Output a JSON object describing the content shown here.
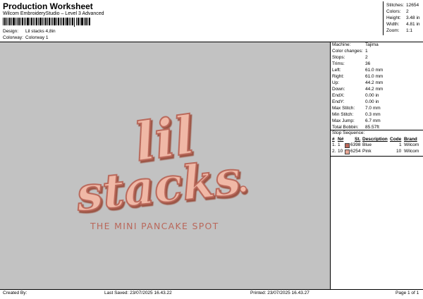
{
  "header": {
    "title": "Production Worksheet",
    "subtitle": "Wilcom EmbroideryStudio – Level 3 Advanced",
    "design_label": "Design:",
    "design_value": "Lil stacks 4,8in",
    "colorway_label": "Colorway:",
    "colorway_value": "Colorway 1"
  },
  "stats": [
    {
      "label": "Stitches:",
      "value": "12654"
    },
    {
      "label": "Colors:",
      "value": "2"
    },
    {
      "label": "Height:",
      "value": "3.48 in"
    },
    {
      "label": "Width:",
      "value": "4.81 in"
    },
    {
      "label": "Zoom:",
      "value": "1:1"
    }
  ],
  "machine_info": [
    {
      "label": "Machine:",
      "value": "Tajima"
    },
    {
      "label": "Color changes:",
      "value": "1"
    },
    {
      "label": "Stops:",
      "value": "2"
    },
    {
      "label": "Trims:",
      "value": "36"
    },
    {
      "label": "Left:",
      "value": "61.0 mm"
    },
    {
      "label": "Right:",
      "value": "61.0 mm"
    },
    {
      "label": "Up:",
      "value": "44.2 mm"
    },
    {
      "label": "Down:",
      "value": "44.2 mm"
    },
    {
      "label": "EndX:",
      "value": "0.00 in"
    },
    {
      "label": "EndY:",
      "value": "0.00 in"
    },
    {
      "label": "Max Stitch:",
      "value": "7.0 mm"
    },
    {
      "label": "Min Stitch:",
      "value": "0.3 mm"
    },
    {
      "label": "Max Jump:",
      "value": "6.7 mm"
    },
    {
      "label": "Total Bobbin:",
      "value": "85.57ft"
    }
  ],
  "stop_sequence": {
    "title": "Stop Sequence:",
    "headers": {
      "num": "#",
      "n": "N#",
      "st": "St.",
      "desc": "Description",
      "code": "Code",
      "brand": "Brand"
    },
    "rows": [
      {
        "num": "1.",
        "n": "1",
        "st": "6398",
        "desc": "Blue",
        "code": "1",
        "brand": "Wilcom",
        "color": "#b9675a"
      },
      {
        "num": "2.",
        "n": "10",
        "st": "6254",
        "desc": "Pink",
        "code": "10",
        "brand": "Wilcom",
        "color": "#e7a695"
      }
    ]
  },
  "design": {
    "line1": "lil",
    "line2": "stacks",
    "dot": ".",
    "tagline": "THE MINI PANCAKE SPOT",
    "thread_light": "#f0b8a6",
    "thread_dark": "#b9675a",
    "background": "#c2c2c2"
  },
  "footer": {
    "created_by": "Created By:",
    "last_saved": "Last Saved: 23/07/2025 16.43.22",
    "printed": "Printed: 23/07/2025 16.43.27",
    "page": "Page 1 of 1"
  }
}
